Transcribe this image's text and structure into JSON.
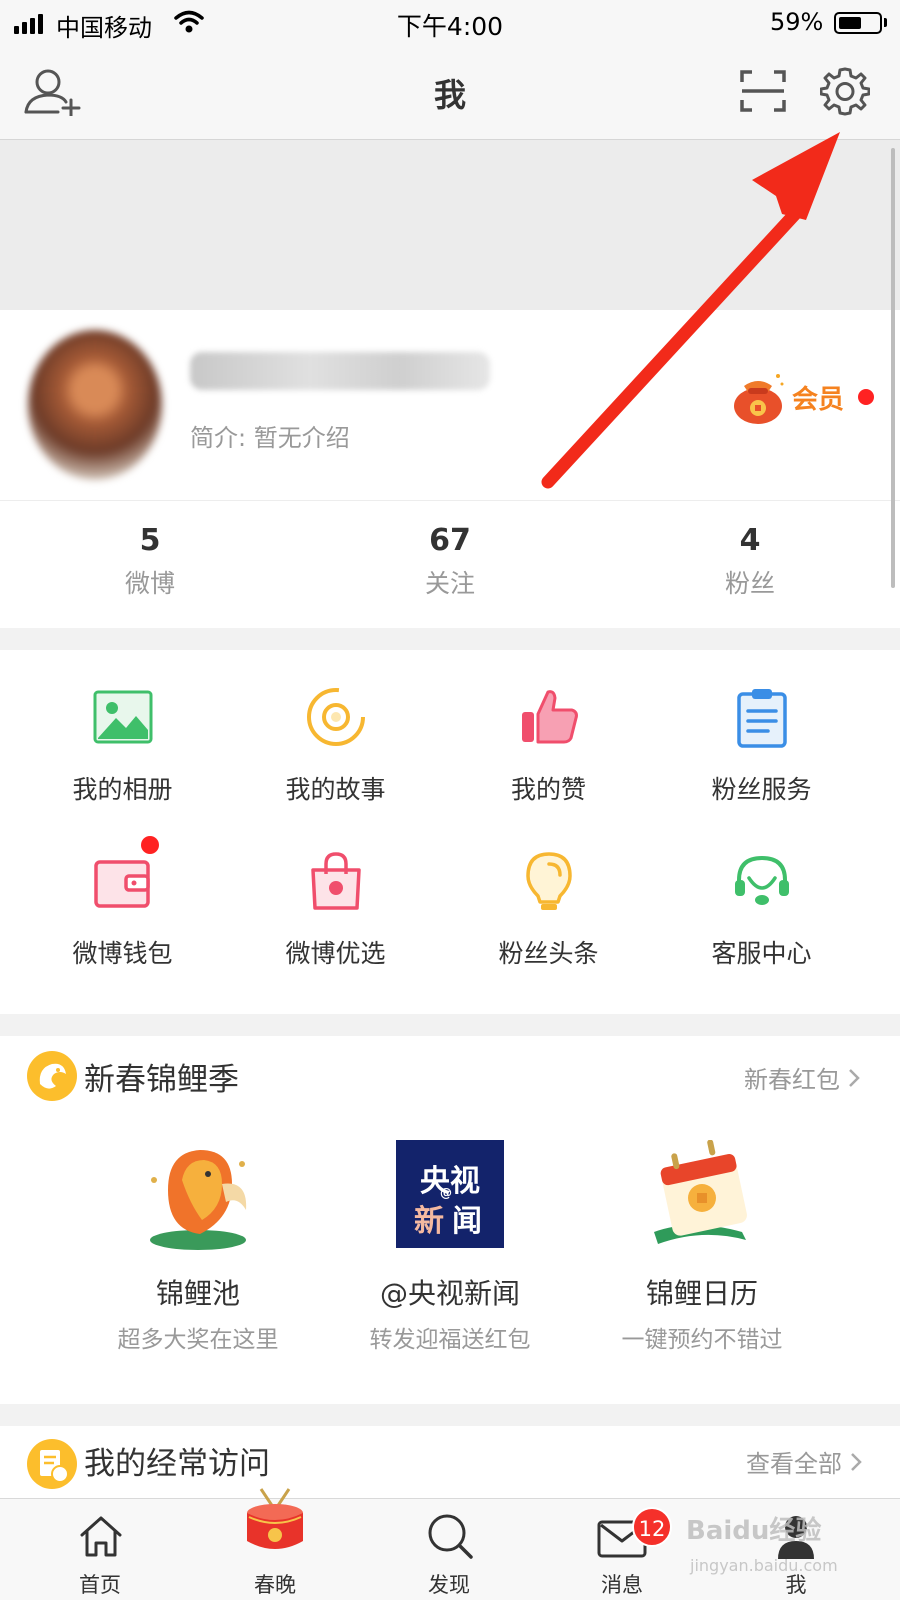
{
  "status_bar": {
    "carrier": "中国移动",
    "time": "下午4:00",
    "battery_percent": "59%",
    "battery_level": 0.59
  },
  "nav": {
    "title": "我",
    "left_icon": "add-friend-icon",
    "right_icons": [
      "scan-icon",
      "settings-gear-icon"
    ]
  },
  "profile": {
    "bio": "简介: 暂无介绍",
    "vip_label": "会员"
  },
  "stats": [
    {
      "value": "5",
      "label": "微博"
    },
    {
      "value": "67",
      "label": "关注"
    },
    {
      "value": "4",
      "label": "粉丝"
    }
  ],
  "grid": {
    "row1": [
      {
        "label": "我的相册",
        "icon": "album-icon"
      },
      {
        "label": "我的故事",
        "icon": "story-icon"
      },
      {
        "label": "我的赞",
        "icon": "thumbs-up-icon"
      },
      {
        "label": "粉丝服务",
        "icon": "clipboard-icon"
      }
    ],
    "row2": [
      {
        "label": "微博钱包",
        "icon": "wallet-icon"
      },
      {
        "label": "微博优选",
        "icon": "shopping-bag-icon"
      },
      {
        "label": "粉丝头条",
        "icon": "lightbulb-icon"
      },
      {
        "label": "客服中心",
        "icon": "headset-icon"
      }
    ]
  },
  "koi_section": {
    "title": "新春锦鲤季",
    "link": "新春红包",
    "items": [
      {
        "name": "锦鲤池",
        "sub": "超多大奖在这里"
      },
      {
        "name": "@央视新闻",
        "sub": "转发迎福送红包",
        "logo_line1": "央视",
        "logo_line2a": "新",
        "logo_line2b": "闻",
        "logo_at": "@"
      },
      {
        "name": "锦鲤日历",
        "sub": "一键预约不错过"
      }
    ]
  },
  "frequent_section": {
    "title": "我的经常访问",
    "link": "查看全部"
  },
  "tab_bar": {
    "tabs": [
      {
        "label": "首页",
        "icon": "home-icon"
      },
      {
        "label": "春晚",
        "icon": "drum-icon"
      },
      {
        "label": "发现",
        "icon": "search-icon"
      },
      {
        "label": "消息",
        "icon": "mail-icon",
        "badge": "12"
      },
      {
        "label": "我",
        "icon": "profile-icon"
      }
    ]
  },
  "watermark": {
    "text": "Baidu经验",
    "sub": "jingyan.baidu.com"
  },
  "colors": {
    "accent_orange": "#f5821f",
    "badge_red": "#f5302a",
    "arrow_red": "#f22a1a"
  }
}
